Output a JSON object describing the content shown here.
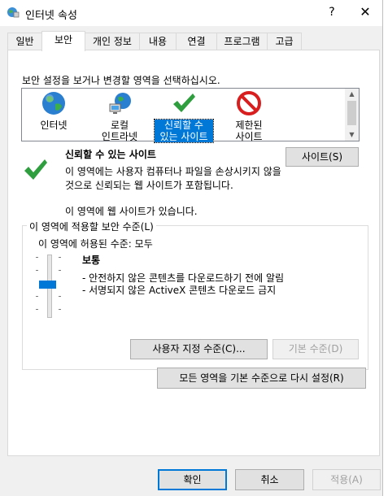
{
  "window": {
    "title": "인터넷 속성",
    "help_label": "?",
    "close_label": "✕"
  },
  "tabs": [
    {
      "label": "일반"
    },
    {
      "label": "보안"
    },
    {
      "label": "개인 정보"
    },
    {
      "label": "내용"
    },
    {
      "label": "연결"
    },
    {
      "label": "프로그램"
    },
    {
      "label": "고급"
    }
  ],
  "active_tab": "보안",
  "security": {
    "instruction": "보안 설정을 보거나 변경할 영역을 선택하십시오.",
    "zones": [
      {
        "label_line1": "인터넷",
        "label_line2": "",
        "icon": "globe-icon"
      },
      {
        "label_line1": "로컬",
        "label_line2": "인트라넷",
        "icon": "intranet-icon"
      },
      {
        "label_line1": "신뢰할 수",
        "label_line2": "있는 사이트",
        "icon": "checkmark-icon",
        "selected": true
      },
      {
        "label_line1": "제한된",
        "label_line2": "사이트",
        "icon": "restricted-icon"
      }
    ],
    "selected_zone": {
      "title": "신뢰할 수 있는 사이트",
      "description": "이 영역에는 사용자 컴퓨터나 파일을 손상시키지 않을 것으로 신뢰되는 웹 사이트가 포함됩니다.",
      "note": "이 영역에 웹 사이트가 있습니다.",
      "sites_button": "사이트(S)"
    },
    "level_group": {
      "label": "이 영역에 적용할 보안 수준(L)",
      "allowed_levels": "이 영역에 허용된 수준: 모두",
      "level_name": "보통",
      "level_items": [
        "- 안전하지 않은 콘텐츠를 다운로드하기 전에 알림",
        "- 서명되지 않은 ActiveX 콘텐츠 다운로드 금지"
      ],
      "slider_level_fraction": 0.5,
      "custom_button": "사용자 지정 수준(C)...",
      "default_button": "기본 수준(D)"
    },
    "reset_all_button": "모든 영역을 기본 수준으로 다시 설정(R)"
  },
  "footer": {
    "ok": "확인",
    "cancel": "취소",
    "apply": "적용(A)"
  },
  "colors": {
    "accent": "#0078d7",
    "check_green": "#2e9e3e",
    "restricted_red": "#d81e1e"
  }
}
